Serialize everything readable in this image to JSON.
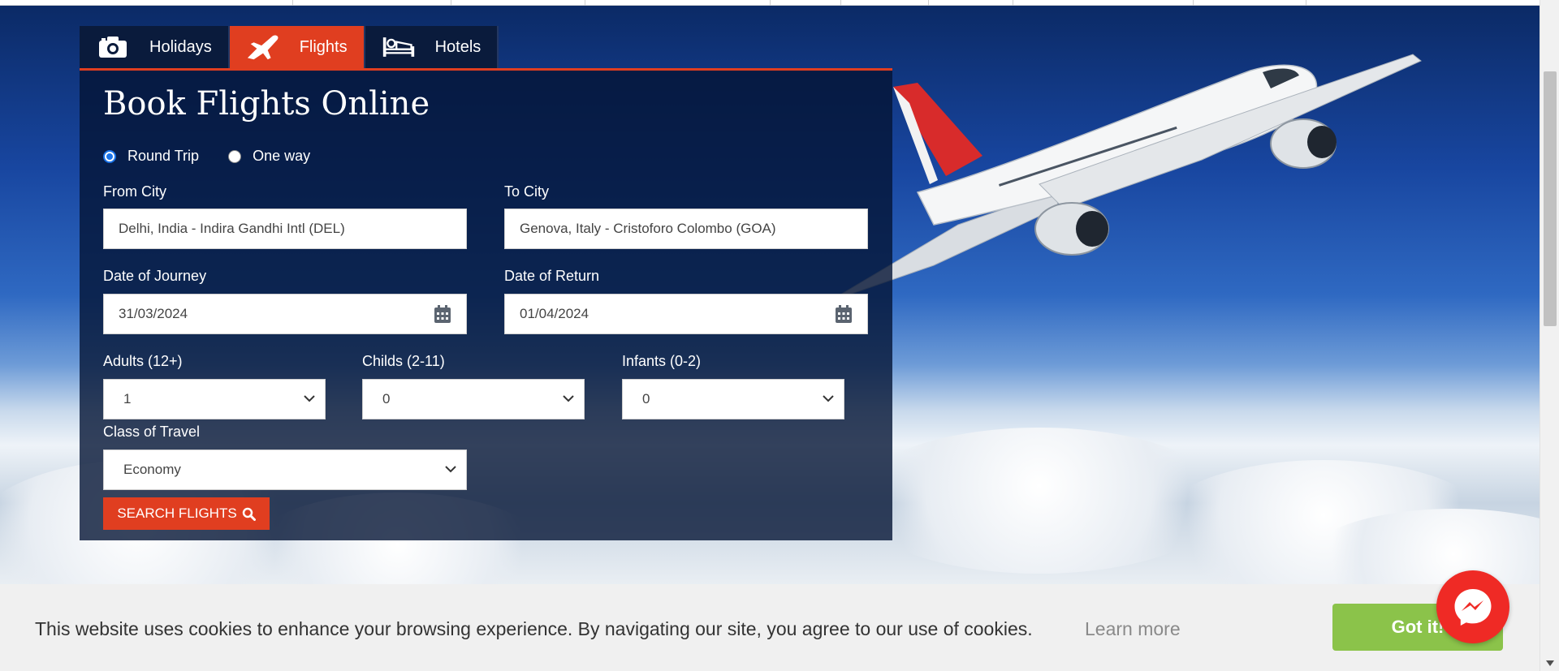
{
  "tabs": [
    {
      "label": "Holidays",
      "icon": "camera-icon",
      "active": false
    },
    {
      "label": "Flights",
      "icon": "airplane-icon",
      "active": true
    },
    {
      "label": "Hotels",
      "icon": "bed-icon",
      "active": false
    }
  ],
  "form": {
    "title": "Book Flights Online",
    "trip_types": [
      "Round Trip",
      "One way"
    ],
    "selected_trip_type": "Round Trip",
    "from_city": {
      "label": "From City",
      "value": "Delhi, India - Indira Gandhi Intl (DEL)"
    },
    "to_city": {
      "label": "To City",
      "value": "Genova, Italy - Cristoforo Colombo (GOA)"
    },
    "date_journey": {
      "label": "Date of Journey",
      "value": "31/03/2024"
    },
    "date_return": {
      "label": "Date of Return",
      "value": "01/04/2024"
    },
    "adults": {
      "label": "Adults (12+)",
      "value": "1"
    },
    "childs": {
      "label": "Childs (2-11)",
      "value": "0"
    },
    "infants": {
      "label": "Infants (0-2)",
      "value": "0"
    },
    "class_of_travel": {
      "label": "Class of Travel",
      "value": "Economy"
    },
    "search_label": "SEARCH FLIGHTS"
  },
  "cookie": {
    "text": "This website uses cookies to enhance your browsing experience. By navigating our site, you agree to our use of cookies.",
    "learn_more": "Learn more",
    "got_it": "Got it!"
  },
  "colors": {
    "accent": "#e03e20",
    "panel": "#041434",
    "cookie_button": "#8bc34a",
    "messenger": "#ef2a25"
  }
}
